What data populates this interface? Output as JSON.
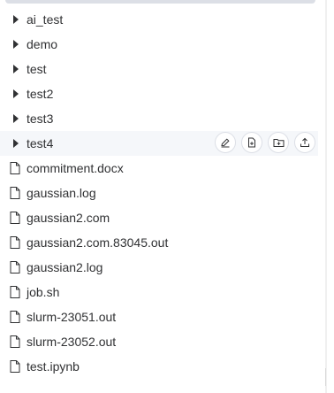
{
  "tree": {
    "folders": [
      {
        "label": "ai_test"
      },
      {
        "label": "demo"
      },
      {
        "label": "test"
      },
      {
        "label": "test2"
      },
      {
        "label": "test3"
      },
      {
        "label": "test4"
      }
    ],
    "files": [
      {
        "label": "commitment.docx"
      },
      {
        "label": "gaussian.log"
      },
      {
        "label": "gaussian2.com"
      },
      {
        "label": "gaussian2.com.83045.out"
      },
      {
        "label": "gaussian2.log"
      },
      {
        "label": "job.sh"
      },
      {
        "label": "slurm-23051.out"
      },
      {
        "label": "slurm-23052.out"
      },
      {
        "label": "test.ipynb"
      }
    ]
  },
  "row_actions": {
    "icons": [
      "edit-icon",
      "new-file-icon",
      "new-folder-icon",
      "upload-icon"
    ]
  },
  "colors": {
    "text": "#303133",
    "hover_bg": "#f5f7fa",
    "border": "#dcdfe6"
  }
}
